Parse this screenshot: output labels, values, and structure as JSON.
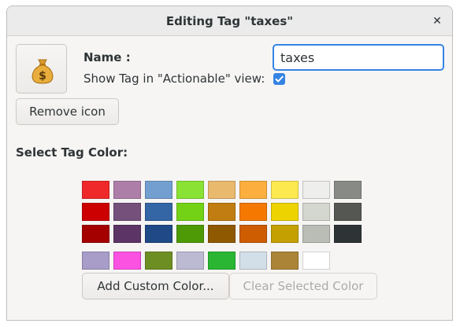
{
  "window": {
    "title": "Editing Tag \"taxes\""
  },
  "icons": {
    "close": "close-icon",
    "tag_icon": "money-bag-icon",
    "checkbox": "checkmark-icon"
  },
  "tag_icon_button": {
    "glyph": "$"
  },
  "remove_icon_button": {
    "label": "Remove icon"
  },
  "name": {
    "label": "Name :",
    "value": "taxes"
  },
  "actionable": {
    "label": "Show Tag in \"Actionable\" view:",
    "checked": true
  },
  "color_section": {
    "label": "Select Tag Color:"
  },
  "palette": {
    "rows": [
      [
        "#ef2929",
        "#ad7fa8",
        "#729fcf",
        "#8ae234",
        "#e9b96e",
        "#fcaf3e",
        "#fce94f",
        "#eeeeec",
        "#888a85"
      ],
      [
        "#cc0000",
        "#75507b",
        "#3465a4",
        "#73d216",
        "#c17d11",
        "#f57900",
        "#edd400",
        "#d3d7cf",
        "#555753"
      ],
      [
        "#a40000",
        "#5c3566",
        "#204a87",
        "#4e9a06",
        "#8f5902",
        "#ce5c00",
        "#c4a000",
        "#babdb6",
        "#2e3436"
      ]
    ],
    "custom": [
      "#a89cc8",
      "#fb52e2",
      "#6d8e23",
      "#bcb9d2",
      "#2ab632",
      "#d3dfe8",
      "#ac8438",
      "#ffffff"
    ]
  },
  "buttons": {
    "add_custom": "Add Custom Color...",
    "clear_selected": "Clear Selected Color"
  },
  "accent_color": "#3584e4"
}
